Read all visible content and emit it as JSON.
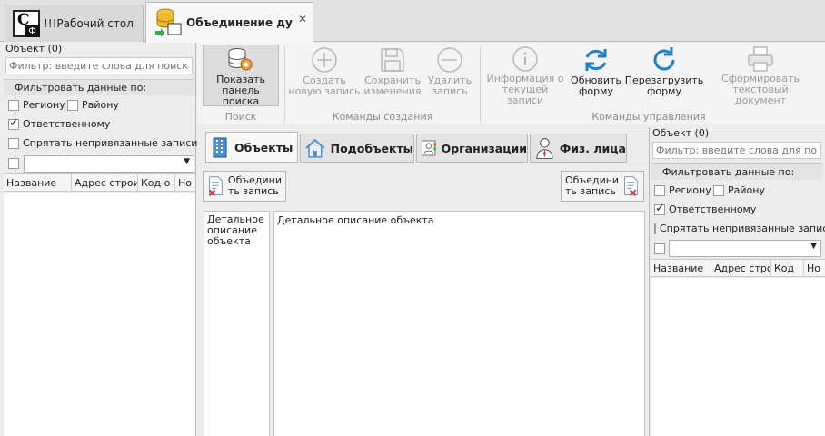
{
  "doc_tabs": [
    {
      "label": "!!!Рабочий стол",
      "icon": "cf-logo-icon"
    },
    {
      "label": "Объединение ду",
      "icon": "database-merge-icon",
      "close": "✕"
    }
  ],
  "left_panel": {
    "title": "Объект (0)",
    "search_placeholder": "Фильтр: введите слова для поиска",
    "filter_group": "Фильтровать данные по:",
    "region": "Региону",
    "district": "Району",
    "responsible": "Ответственному",
    "hide_unlinked": "Спрятать непривязанные записи",
    "columns": [
      "Название",
      "Адрес строи",
      "Код о",
      "Но"
    ]
  },
  "right_panel": {
    "title": "Объект (0)",
    "search_placeholder": "Фильтр: введите слова для поиска",
    "filter_group": "Фильтровать данные по:",
    "region": "Региону",
    "district": "Району",
    "responsible": "Ответственному",
    "hide_unlinked": "Спрятать непривязанные записи",
    "columns": [
      "Название",
      "Адрес стро",
      "Код",
      "Но"
    ]
  },
  "ribbon": {
    "search_btn": [
      "Показать",
      "панель поиска"
    ],
    "create_btn": [
      "Создать",
      "новую запись"
    ],
    "save_btn": [
      "Сохранить",
      "изменения"
    ],
    "delete_btn": [
      "Удалить",
      "запись"
    ],
    "info_btn": [
      "Информация о",
      "текущей записи"
    ],
    "refresh_btn": [
      "Обновить",
      "форму"
    ],
    "reload_btn": [
      "Перезагрузить",
      "форму"
    ],
    "report_btn": [
      "Сформировать",
      "текстовый документ"
    ],
    "group_search": "Поиск",
    "group_create": "Команды создания",
    "group_manage": "Команды управления"
  },
  "center_tabs": [
    "Объекты",
    "Подобъекты",
    "Организации",
    "Физ. лица"
  ],
  "merge_left": [
    "Объедини",
    "ть запись"
  ],
  "merge_right": [
    "Объедини",
    "ть запись"
  ],
  "side_label": "Детальное описание объекта",
  "main_label": "Детальное описание объекта",
  "colors": {
    "accent_blue": "#1f7fc9",
    "icon_gray": "#b8b8b8"
  }
}
